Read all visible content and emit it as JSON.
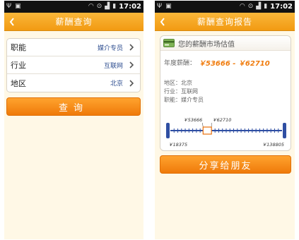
{
  "status": {
    "time": "17:02"
  },
  "left_screen": {
    "title": "薪酬查询",
    "form": [
      {
        "label": "职能",
        "value": "媒介专员"
      },
      {
        "label": "行业",
        "value": "互联网"
      },
      {
        "label": "地区",
        "value": "北京"
      }
    ],
    "query_button": "查询"
  },
  "right_screen": {
    "title": "薪酬查询报告",
    "card_title": "您的薪酬市场估值",
    "annual_label": "年度薪酬：",
    "annual_range": "￥53666 - ￥62710",
    "region": "地区：北京",
    "industry": "行业：互联网",
    "position": "职能：媒介专员",
    "scale": {
      "min_label": "￥18375",
      "max_label": "￥138805",
      "low_label": "￥53666",
      "high_label": "￥62710",
      "min": 18375,
      "max": 138805,
      "low": 53666,
      "high": 62710
    },
    "share_button": "分享给朋友"
  },
  "colors": {
    "accent": "#f29a12",
    "button": "#ef7a0a",
    "value_blue": "#2c4c8f",
    "range_orange": "#f07b0c",
    "scale_blue": "#2f4fa3"
  }
}
